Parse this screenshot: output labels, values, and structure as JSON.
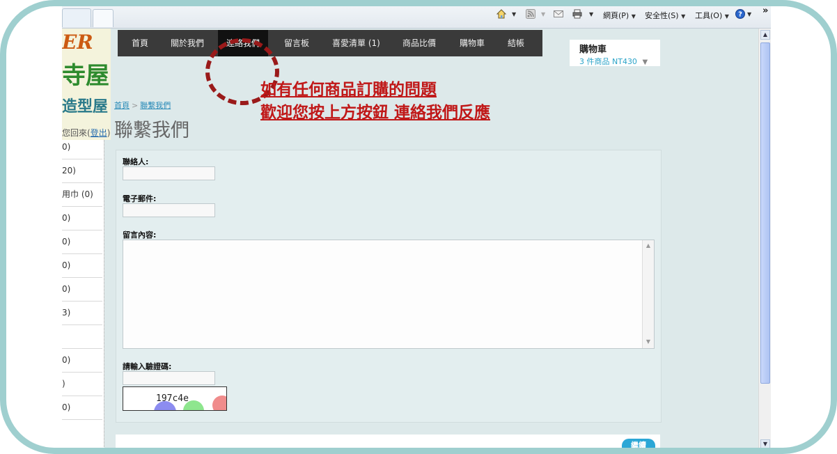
{
  "browser": {
    "commands": [
      {
        "label": "網頁(P)",
        "icon": "page-menu"
      },
      {
        "label": "安全性(S)",
        "icon": "safety-menu"
      },
      {
        "label": "工具(O)",
        "icon": "tools-menu"
      }
    ],
    "overflow": "»"
  },
  "logo": {
    "line1": "ER",
    "line2": "寺屋",
    "line3": "造型屋"
  },
  "greeting": {
    "prefix": "您回來(",
    "logout": "登出",
    "suffix": ")"
  },
  "categories": [
    "0)",
    "20)",
    "用巾 (0)",
    "0)",
    "0)",
    "0)",
    "0)",
    "3)",
    "",
    "0)",
    ")",
    "0)"
  ],
  "nav": {
    "items": [
      "首頁",
      "關於我們",
      "連絡我們",
      "留言板",
      "喜愛清單 (1)",
      "商品比價",
      "購物車",
      "結帳"
    ],
    "active_index": 2
  },
  "cart": {
    "title": "購物車",
    "summary": "3 件商品 NT430"
  },
  "breadcrumb": {
    "home": "首頁",
    "separator": ">",
    "current": "聯繫我們"
  },
  "page_title": "聯繫我們",
  "notice": {
    "line1": "如有任何商品訂購的問題",
    "line2": "歡迎您按上方按鈕  連絡我們反應"
  },
  "form": {
    "name_label": "聯絡人:",
    "name_value": "",
    "email_label": "電子郵件:",
    "email_value": "",
    "message_label": "留言內容:",
    "message_value": "",
    "captcha_label": "請輸入驗證碼:",
    "captcha_value": "",
    "captcha_code": "197c4e"
  },
  "continue_label": "繼續",
  "colors": {
    "frame": "#9fcfcf",
    "nav_bg": "#3a3a3a",
    "nav_active": "#111111",
    "notice": "#c01818",
    "link": "#2a8bb8",
    "button": "#2ba7d6",
    "circle": "#9a1a1a"
  }
}
